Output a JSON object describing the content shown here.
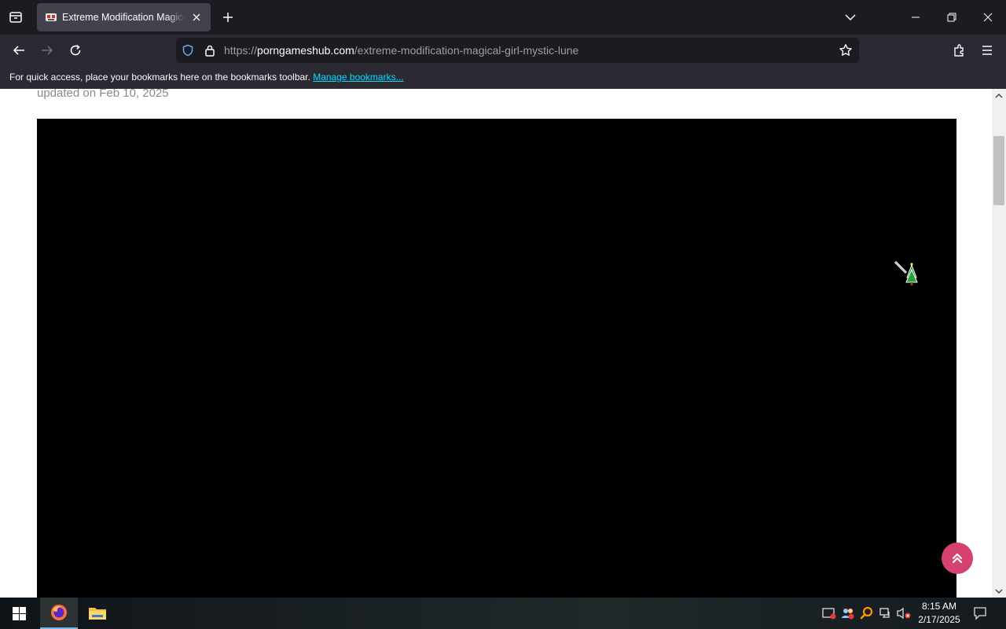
{
  "browser": {
    "tab": {
      "title": "Extreme Modification Magical Girl: Mystic Lune"
    },
    "url": {
      "prefix": "https://",
      "domain": "porngameshub.com",
      "path": "/extreme-modification-magical-girl-mystic-lune"
    },
    "bookmarks_bar": {
      "message": "For quick access, place your bookmarks here on the bookmarks toolbar.",
      "link": "Manage bookmarks..."
    }
  },
  "page": {
    "updated_text": "updated on Feb 10, 2025"
  },
  "taskbar": {
    "time": "8:15 AM",
    "date": "2/17/2025"
  },
  "colors": {
    "tab_bg": "#1c1b22",
    "toolbar_bg": "#2b2a33",
    "active_tab": "#42414d",
    "link": "#00ddff",
    "scroll_top_button": "#d6426f",
    "video_bg": "#000000"
  }
}
